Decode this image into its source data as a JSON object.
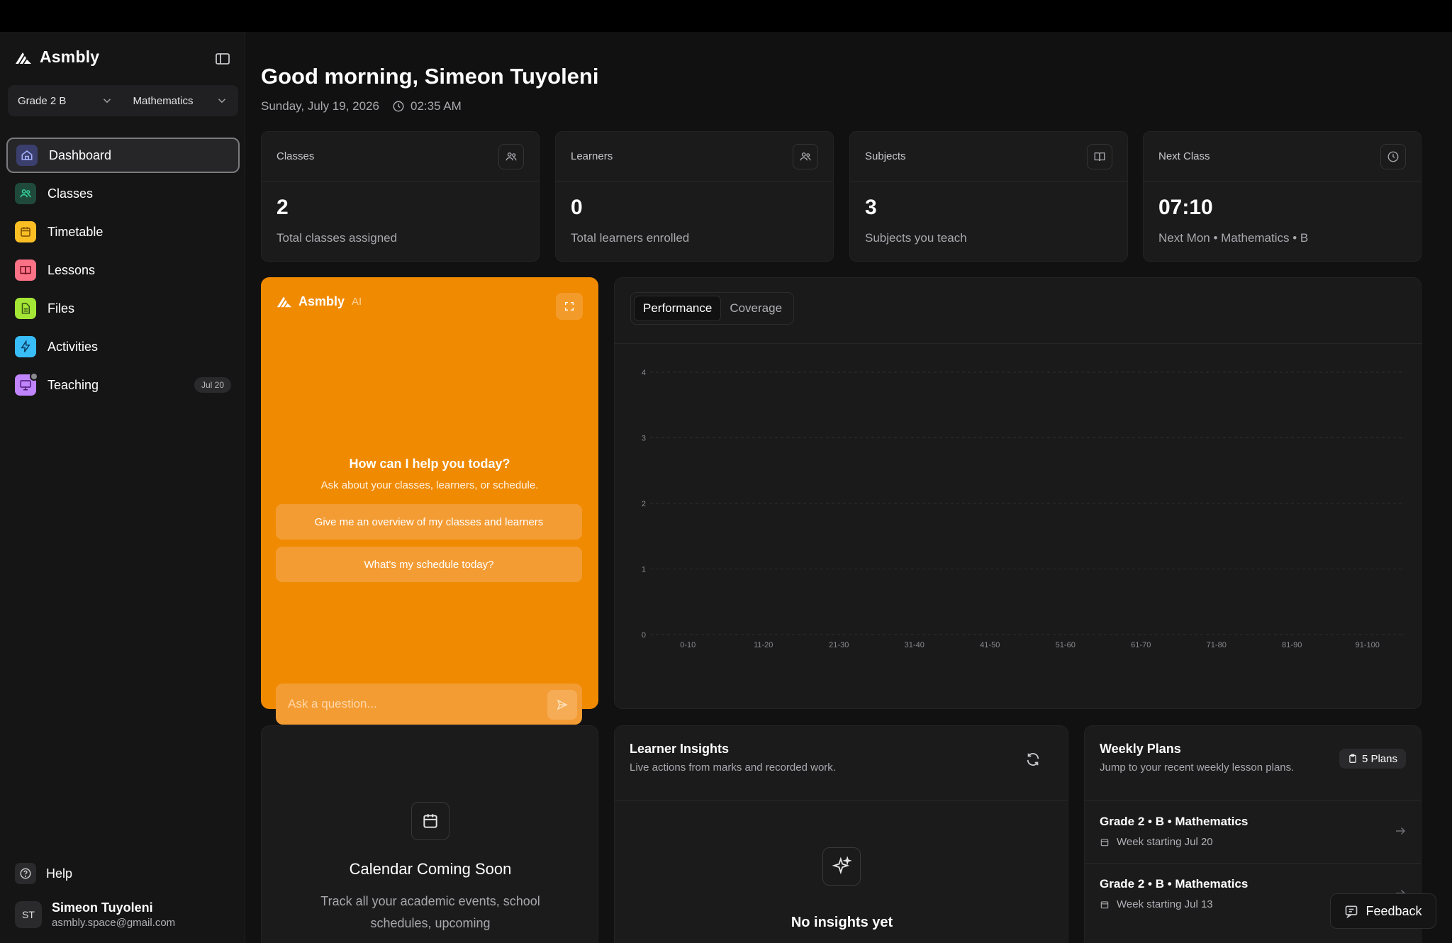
{
  "brand": {
    "name": "Asmbly"
  },
  "selectors": {
    "grade": "Grade 2 B",
    "subject": "Mathematics"
  },
  "nav": [
    {
      "label": "Dashboard",
      "icon": "home-icon",
      "color": "#818cf8",
      "active": true
    },
    {
      "label": "Classes",
      "icon": "users-icon",
      "color": "#34d399"
    },
    {
      "label": "Timetable",
      "icon": "calendar-icon",
      "color": "#fbbf24"
    },
    {
      "label": "Lessons",
      "icon": "book-icon",
      "color": "#fb7185"
    },
    {
      "label": "Files",
      "icon": "file-icon",
      "color": "#a3e635"
    },
    {
      "label": "Activities",
      "icon": "bolt-icon",
      "color": "#38bdf8"
    },
    {
      "label": "Teaching",
      "icon": "presentation-icon",
      "color": "#c084fc",
      "badge": "Jul 20"
    }
  ],
  "help": {
    "label": "Help"
  },
  "user": {
    "initials": "ST",
    "name": "Simeon Tuyoleni",
    "email": "asmbly.space@gmail.com"
  },
  "header": {
    "greeting": "Good morning, Simeon Tuyoleni",
    "date": "Sunday, July 19, 2026",
    "time": "02:35 AM"
  },
  "stats": [
    {
      "title": "Classes",
      "value": "2",
      "desc": "Total classes assigned",
      "icon": "users-icon"
    },
    {
      "title": "Learners",
      "value": "0",
      "desc": "Total learners enrolled",
      "icon": "users-icon"
    },
    {
      "title": "Subjects",
      "value": "3",
      "desc": "Subjects you teach",
      "icon": "book-open-icon"
    },
    {
      "title": "Next Class",
      "value": "07:10",
      "desc": "Next Mon • Mathematics • B",
      "icon": "clock-icon"
    }
  ],
  "ai": {
    "brand": "Asmbly",
    "tag": "AI",
    "question": "How can I help you today?",
    "subtitle": "Ask about your classes, learners, or schedule.",
    "suggestions": [
      "Give me an overview of my classes and learners",
      "What's my schedule today?"
    ],
    "placeholder": "Ask a question...",
    "accent": "#f08a00"
  },
  "chart_tabs": [
    "Performance",
    "Coverage"
  ],
  "chart_data": {
    "type": "bar",
    "categories": [
      "0-10",
      "11-20",
      "21-30",
      "31-40",
      "41-50",
      "51-60",
      "61-70",
      "71-80",
      "81-90",
      "91-100"
    ],
    "values": [
      0,
      0,
      0,
      0,
      0,
      0,
      0,
      0,
      0,
      0
    ],
    "yticks": [
      0,
      1,
      2,
      3,
      4
    ],
    "ylim": [
      0,
      4
    ],
    "grid": true
  },
  "calendar": {
    "title": "Calendar Coming Soon",
    "text": "Track all your academic events, school schedules, upcoming"
  },
  "insights": {
    "title": "Learner Insights",
    "subtitle": "Live actions from marks and recorded work.",
    "empty": "No insights yet"
  },
  "plans": {
    "title": "Weekly Plans",
    "subtitle": "Jump to your recent weekly lesson plans.",
    "badge": "5 Plans",
    "items": [
      {
        "title": "Grade 2 • B • Mathematics",
        "week": "Week starting Jul 20"
      },
      {
        "title": "Grade 2 • B • Mathematics",
        "week": "Week starting Jul 13"
      }
    ]
  },
  "feedback": {
    "label": "Feedback"
  }
}
